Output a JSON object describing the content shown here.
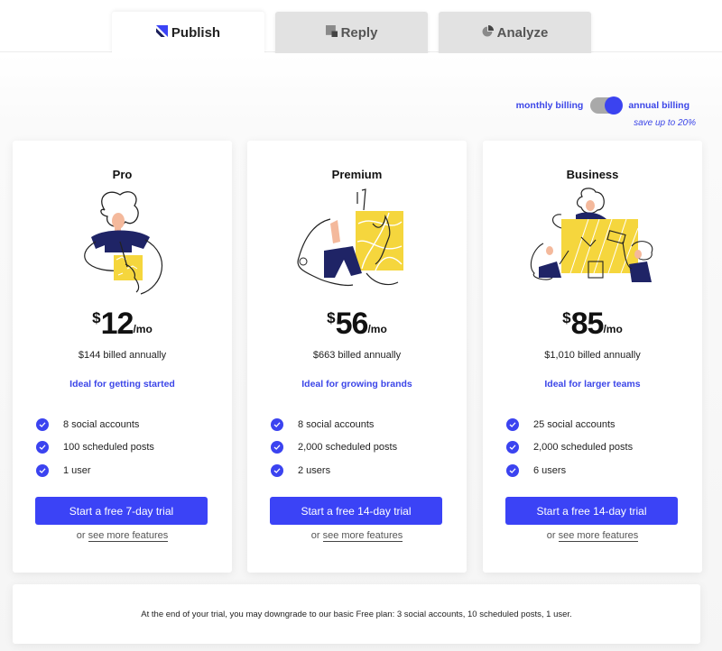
{
  "tabs": [
    {
      "label": "Publish",
      "icon": "publish-icon",
      "active": true
    },
    {
      "label": "Reply",
      "icon": "reply-icon",
      "active": false
    },
    {
      "label": "Analyze",
      "icon": "analyze-icon",
      "active": false
    }
  ],
  "billing": {
    "monthly_label": "monthly billing",
    "annual_label": "annual billing",
    "selected": "annual",
    "save_note": "save up to 20%"
  },
  "plans": [
    {
      "name": "Pro",
      "illustration": "person-writing-illustration",
      "currency": "$",
      "price": "12",
      "period": "/mo",
      "billed": "$144 billed annually",
      "ideal": "Ideal for getting started",
      "features": [
        "8 social accounts",
        "100 scheduled posts",
        "1 user"
      ],
      "cta": "Start a free 7-day trial",
      "more_prefix": "or",
      "more_link": "see more features"
    },
    {
      "name": "Premium",
      "illustration": "person-at-board-illustration",
      "currency": "$",
      "price": "56",
      "period": "/mo",
      "billed": "$663 billed annually",
      "ideal": "Ideal for growing brands",
      "features": [
        "8 social accounts",
        "2,000 scheduled posts",
        "2 users"
      ],
      "cta": "Start a free 14-day trial",
      "more_prefix": "or",
      "more_link": "see more features"
    },
    {
      "name": "Business",
      "illustration": "team-collaborating-illustration",
      "currency": "$",
      "price": "85",
      "period": "/mo",
      "billed": "$1,010 billed annually",
      "ideal": "Ideal for larger teams",
      "features": [
        "25 social accounts",
        "2,000 scheduled posts",
        "6 users"
      ],
      "cta": "Start a free 14-day trial",
      "more_prefix": "or",
      "more_link": "see more features"
    }
  ],
  "footer_note": "At the end of your trial, you may downgrade to our basic Free plan: 3 social accounts, 10 scheduled posts, 1 user.",
  "colors": {
    "accent": "#3b43f6",
    "accent_text": "#3c46e8",
    "illustration_yellow": "#f5d63d",
    "illustration_navy": "#1f2466",
    "skin": "#f4b99c"
  }
}
